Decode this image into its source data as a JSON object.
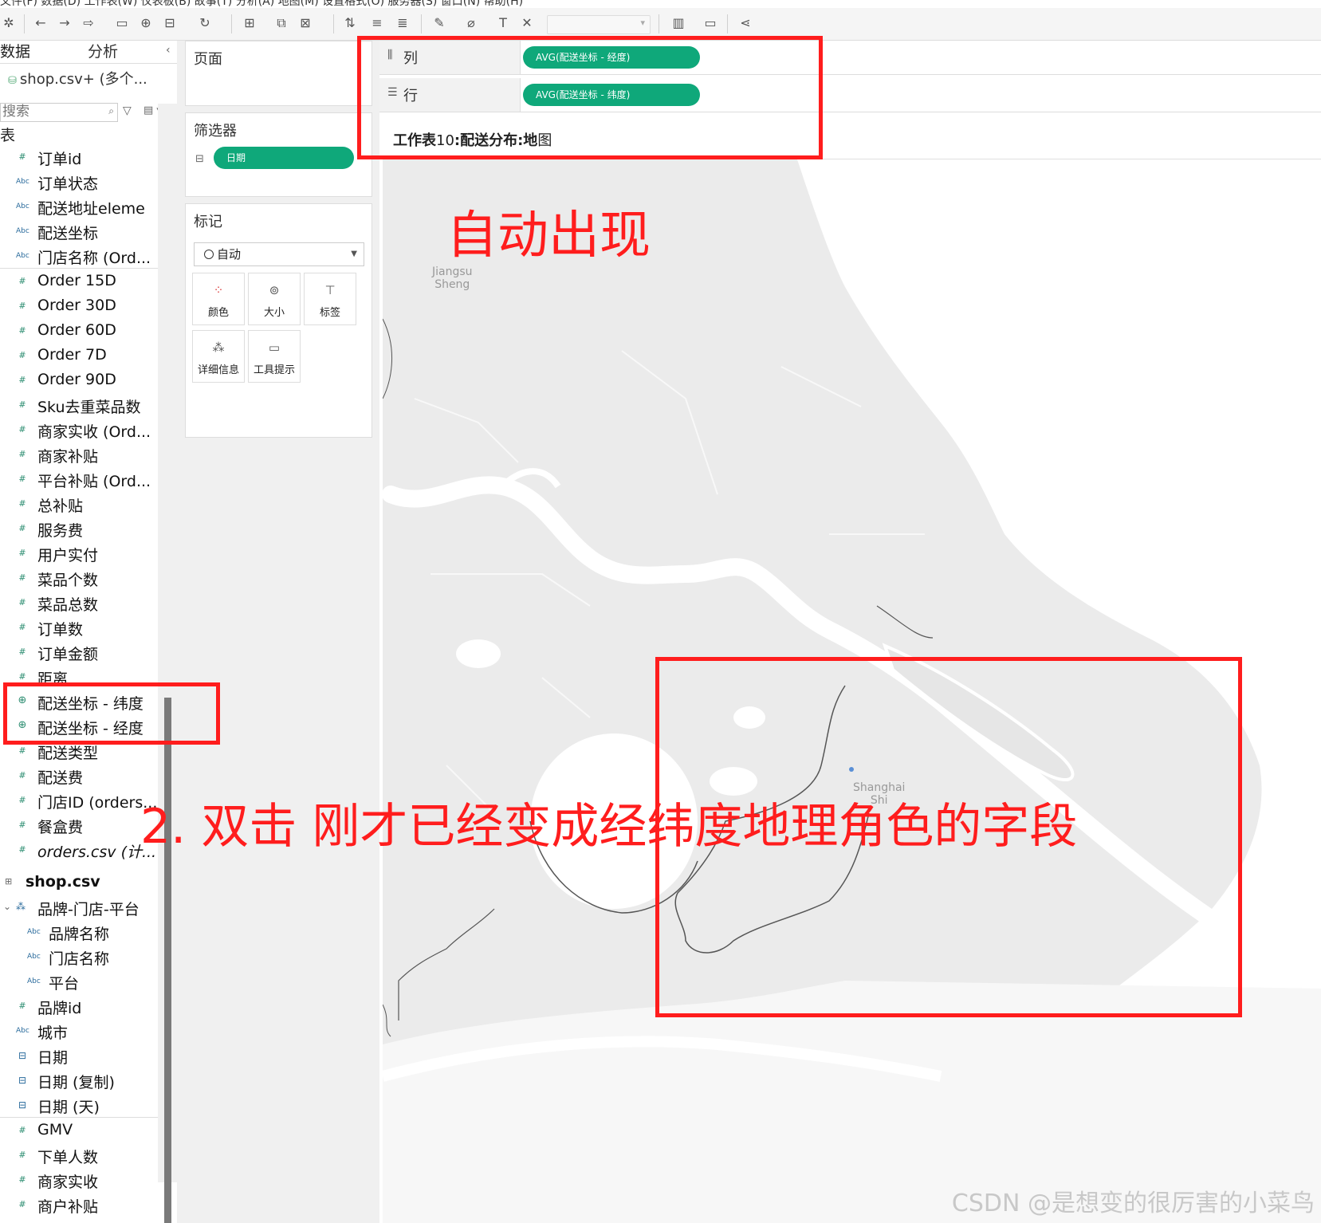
{
  "menubar": {
    "text": "文件(F)   数据(D)   工作表(W)   仪表板(B)   故事(T)   分析(A)   地图(M)   设置格式(O)   服务器(S)   窗口(N)   帮助(H)"
  },
  "datapane": {
    "tab_data": "数据",
    "tab_analysis": "分析",
    "source": "shop.csv+ (多个...",
    "search_placeholder": "搜索",
    "table_header": "表",
    "fields": [
      {
        "label": "订单id",
        "type": "num"
      },
      {
        "label": "订单状态",
        "type": "abc"
      },
      {
        "label": "配送地址eleme",
        "type": "abc"
      },
      {
        "label": "配送坐标",
        "type": "abc"
      },
      {
        "label": "门店名称 (Ord...",
        "type": "abc"
      },
      {
        "label": "Order 15D",
        "type": "num"
      },
      {
        "label": "Order 30D",
        "type": "num"
      },
      {
        "label": "Order 60D",
        "type": "num"
      },
      {
        "label": "Order 7D",
        "type": "num"
      },
      {
        "label": "Order 90D",
        "type": "num"
      },
      {
        "label": "Sku去重菜品数",
        "type": "num"
      },
      {
        "label": "商家实收 (Ord...",
        "type": "num"
      },
      {
        "label": "商家补贴",
        "type": "num"
      },
      {
        "label": "平台补贴 (Ord...",
        "type": "num"
      },
      {
        "label": "总补贴",
        "type": "num"
      },
      {
        "label": "服务费",
        "type": "num"
      },
      {
        "label": "用户实付",
        "type": "num"
      },
      {
        "label": "菜品个数",
        "type": "num"
      },
      {
        "label": "菜品总数",
        "type": "num"
      },
      {
        "label": "订单数",
        "type": "num"
      },
      {
        "label": "订单金额",
        "type": "num"
      },
      {
        "label": "距离",
        "type": "num"
      },
      {
        "label": "配送坐标 - 纬度",
        "type": "geo"
      },
      {
        "label": "配送坐标 - 经度",
        "type": "geo"
      },
      {
        "label": "配送类型",
        "type": "num"
      },
      {
        "label": "配送费",
        "type": "num"
      },
      {
        "label": "门店ID (orders...",
        "type": "num"
      },
      {
        "label": "餐盒费",
        "type": "num"
      },
      {
        "label": "orders.csv (计...",
        "type": "num"
      }
    ],
    "shop_group": "shop.csv",
    "hierarchy": "品牌-门店-平台",
    "hierarchy_fields": [
      "品牌名称",
      "门店名称",
      "平台"
    ],
    "shop_fields": [
      {
        "label": "品牌id",
        "type": "num"
      },
      {
        "label": "城市",
        "type": "abc"
      },
      {
        "label": "日期",
        "type": "date"
      },
      {
        "label": "日期 (复制)",
        "type": "date"
      },
      {
        "label": "日期 (天)",
        "type": "date"
      },
      {
        "label": "GMV",
        "type": "num"
      },
      {
        "label": "下单人数",
        "type": "num"
      },
      {
        "label": "商家实收",
        "type": "num"
      },
      {
        "label": "商户补贴",
        "type": "num"
      }
    ]
  },
  "cards": {
    "pages": "页面",
    "filters": "筛选器",
    "filter_pill": "日期",
    "marks": "标记",
    "marks_type": "自动",
    "mark_buttons": [
      "颜色",
      "大小",
      "标签",
      "详细信息",
      "工具提示"
    ]
  },
  "shelves": {
    "columns_label": "列",
    "columns_pill": "AVG(配送坐标 - 经度)",
    "rows_label": "行",
    "rows_pill": "AVG(配送坐标 - 纬度)",
    "sheet_title_prefix": "工作表",
    "sheet_title_num": "10",
    "sheet_title_rest": ":配送分布:地",
    "sheet_title_last": "图"
  },
  "map": {
    "label_jiangsu": "Jiangsu\nSheng",
    "label_shanghai": "Shanghai\nShi"
  },
  "annotations": {
    "auto_appear": "自动出现",
    "step2": "2. 双击 刚才已经变成经纬度地理角色的字段"
  },
  "watermark": "CSDN @是想变的很厉害的小菜鸟",
  "colors": {
    "pill": "#0fa87a",
    "annotation": "#ff1d1d"
  }
}
